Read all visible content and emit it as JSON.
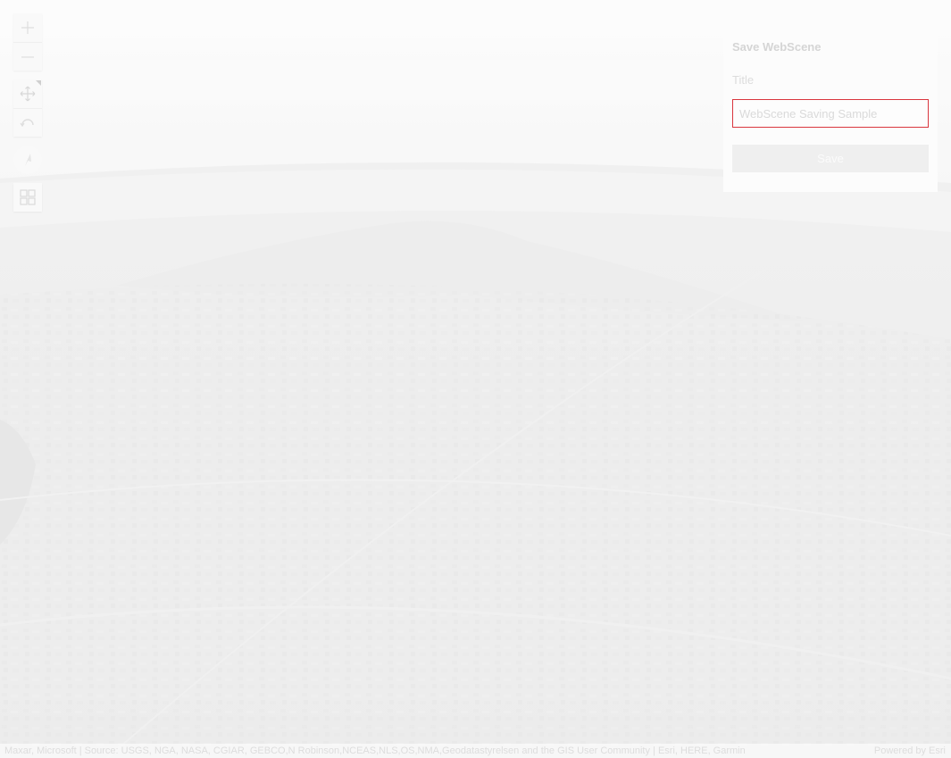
{
  "nav_tools": {
    "zoom_in": "plus-icon",
    "zoom_out": "minus-icon",
    "pan": "move-icon",
    "rotate": "rotate-icon",
    "compass": "compass-icon",
    "layer_list": "grid-icon"
  },
  "save_panel": {
    "heading": "Save WebScene",
    "title_label": "Title",
    "title_value": "WebScene Saving Sample",
    "save_button": "Save"
  },
  "attribution": {
    "sources": "Maxar, Microsoft | Source: USGS, NGA, NASA, CGIAR, GEBCO,N Robinson,NCEAS,NLS,OS,NMA,Geodatastyrelsen and the GIS User Community | Esri, HERE, Garmin",
    "powered_by": "Powered by Esri"
  },
  "colors": {
    "input_border": "#d9363e",
    "panel_bg": "#fcfcfc",
    "scene_bg": "#ededed"
  }
}
